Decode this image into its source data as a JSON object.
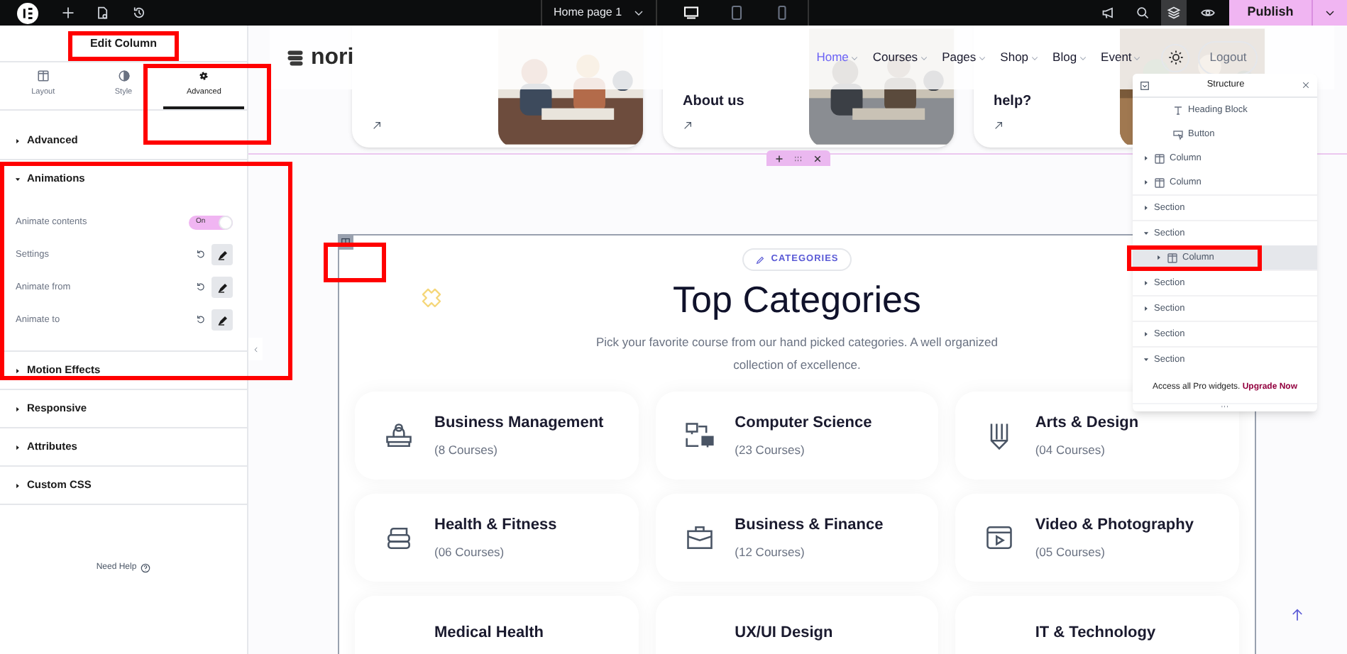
{
  "top_bar": {
    "page_title": "Home page 1",
    "devices": [
      {
        "kind": "desktop",
        "selected": true
      },
      {
        "kind": "tablet",
        "selected": false
      },
      {
        "kind": "mobile",
        "selected": false
      }
    ],
    "layers_selected": true,
    "publish": "Publish"
  },
  "panel": {
    "title": "Edit Column",
    "tabs": [
      {
        "label": "Layout",
        "kind": "layout",
        "selected": false
      },
      {
        "label": "Style",
        "kind": "style",
        "selected": false
      },
      {
        "label": "Advanced",
        "kind": "advanced",
        "selected": true
      }
    ],
    "sections": [
      {
        "label": "Advanced",
        "expanded": false
      },
      {
        "label": "Animations",
        "expanded": true,
        "controls": [
          {
            "kind": "toggle",
            "label": "Animate contents",
            "on": true,
            "value": "On"
          },
          {
            "kind": "edit",
            "label": "Settings"
          },
          {
            "kind": "edit",
            "label": "Animate from"
          },
          {
            "kind": "edit",
            "label": "Animate to"
          }
        ]
      },
      {
        "label": "Motion Effects",
        "expanded": false
      },
      {
        "label": "Responsive",
        "expanded": false
      },
      {
        "label": "Attributes",
        "expanded": false
      },
      {
        "label": "Custom CSS",
        "expanded": false
      }
    ],
    "help": "Need Help"
  },
  "site": {
    "logo": "nori",
    "nav": [
      {
        "label": "Home",
        "selected": true
      },
      {
        "label": "Courses",
        "selected": false
      },
      {
        "label": "Pages",
        "selected": false
      },
      {
        "label": "Shop",
        "selected": false
      },
      {
        "label": "Blog",
        "selected": false
      },
      {
        "label": "Event",
        "selected": false
      }
    ],
    "logout": "Logout",
    "cards": [
      {
        "image": {
          "kind": "picture"
        }
      },
      {
        "title": "About us",
        "image": {
          "kind": "picture"
        }
      },
      {
        "title": "help?",
        "image": {
          "kind": "picture"
        }
      }
    ],
    "categories": {
      "badge": "CATEGORIES",
      "title": "Top Categories",
      "description": "Pick your favorite course from our hand picked categories. A well organized collection of excellence.",
      "items": [
        {
          "kind": "desk",
          "name": "Business Management",
          "count": "(8 Courses)"
        },
        {
          "kind": "computers",
          "name": "Computer Science",
          "count": "(23 Courses)"
        },
        {
          "kind": "pencil",
          "name": "Arts & Design",
          "count": "(04 Courses)"
        },
        {
          "kind": "weight",
          "name": "Health & Fitness",
          "count": "(06 Courses)"
        },
        {
          "kind": "briefcase",
          "name": "Business & Finance",
          "count": "(12 Courses)"
        },
        {
          "kind": "video",
          "name": "Video & Photography",
          "count": "(05 Courses)"
        },
        {
          "kind": "partial",
          "name": "Medical Health"
        },
        {
          "kind": "partial",
          "name": "UX/UI Design"
        },
        {
          "kind": "partial",
          "name": "IT & Technology"
        }
      ]
    }
  },
  "structure": {
    "title": "Structure",
    "items": [
      {
        "kind": "group",
        "children": [
          {
            "kind": "group",
            "children": [
              {
                "kind": "heading",
                "label": "Heading Block",
                "selected": false
              },
              {
                "kind": "button",
                "label": "Button",
                "selected": false
              }
            ]
          },
          {
            "kind": "column",
            "label": "Column",
            "expanded": false,
            "selected": false
          },
          {
            "kind": "column",
            "label": "Column",
            "expanded": false,
            "selected": false
          }
        ]
      },
      {
        "kind": "section",
        "label": "Section",
        "expanded": false,
        "selected": false
      },
      {
        "kind": "section",
        "label": "Section",
        "expanded": true,
        "selected": false,
        "children": [
          {
            "kind": "column",
            "label": "Column",
            "expanded": false,
            "selected": true
          }
        ]
      },
      {
        "kind": "section",
        "label": "Section",
        "expanded": false,
        "selected": false
      },
      {
        "kind": "section",
        "label": "Section",
        "expanded": false,
        "selected": false
      },
      {
        "kind": "section",
        "label": "Section",
        "expanded": false,
        "selected": false
      },
      {
        "kind": "section",
        "label": "Section",
        "expanded": true,
        "selected": false
      }
    ],
    "promo": "Access all Pro widgets.",
    "upgrade": "Upgrade Now"
  }
}
